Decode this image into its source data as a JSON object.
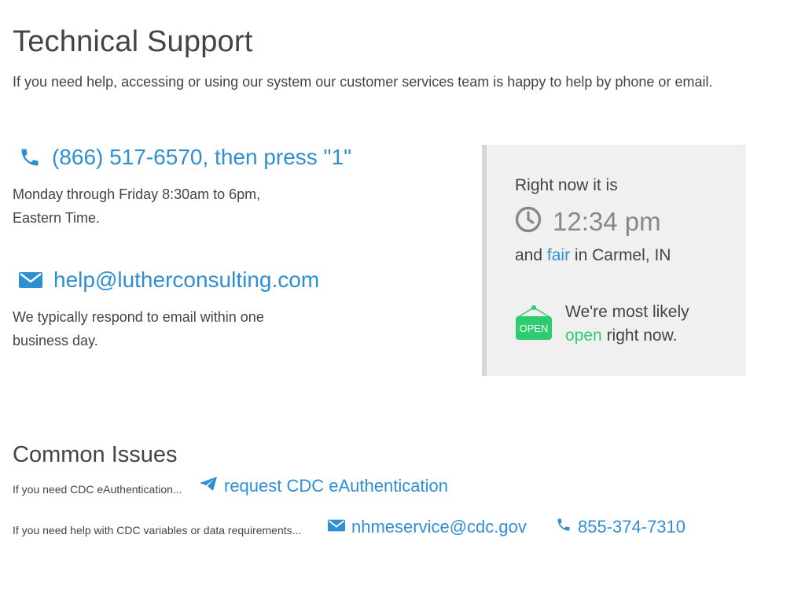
{
  "page": {
    "title": "Technical Support",
    "intro": "If you need help, accessing or using our system our customer services team is happy to help by phone or email."
  },
  "phone": {
    "icon": "phone-icon",
    "label": "(866) 517-6570, then press \"1\"",
    "hours_line1": "Monday through Friday 8:30am to 6pm,",
    "hours_line2": "Eastern Time."
  },
  "email": {
    "icon": "envelope-icon",
    "label": "help@lutherconsulting.com",
    "note_line1": "We typically respond to email within one",
    "note_line2": "business day."
  },
  "status": {
    "now_label": "Right now it is",
    "clock_icon": "clock-icon",
    "time": "12:34 pm",
    "weather_prefix": "and",
    "weather_condition": "fair",
    "weather_suffix": "in Carmel, IN",
    "open_icon": "open-sign-icon",
    "open_sign_text": "OPEN",
    "open_line1": "We're most likely",
    "open_word": "open",
    "open_line2_suffix": "right now."
  },
  "common_issues": {
    "heading": "Common Issues",
    "items": [
      {
        "label": "If you need CDC eAuthentication...",
        "link_icon": "paper-plane-icon",
        "link_label": "request CDC eAuthentication"
      },
      {
        "label": "If you need help with CDC variables or data requirements...",
        "email_icon": "envelope-icon",
        "email_label": "nhmeservice@cdc.gov",
        "phone_icon": "phone-icon",
        "phone_label": "855-374-7310"
      }
    ]
  },
  "colors": {
    "link": "#2f8fd3",
    "open_green": "#2ecc71",
    "text": "#444444",
    "panel_bg": "#f0f0f0",
    "panel_border": "#d6d6d6"
  }
}
